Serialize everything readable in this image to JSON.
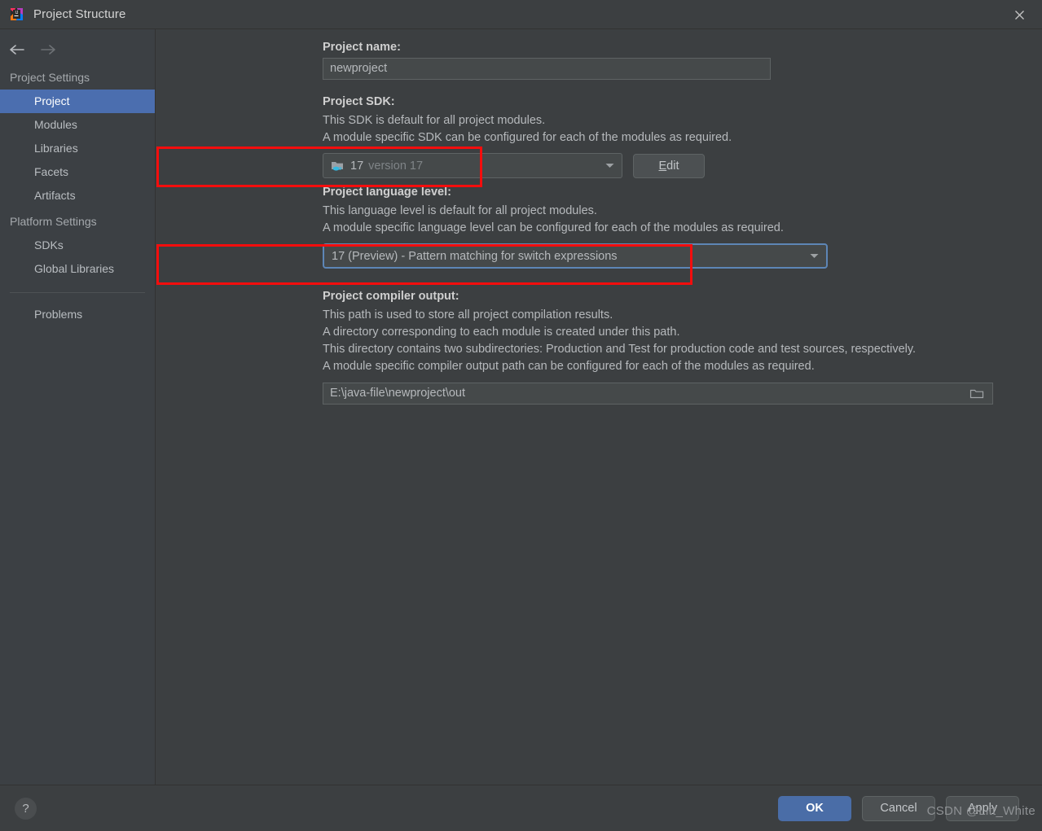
{
  "window": {
    "title": "Project Structure",
    "app_icon": "intellij-idea-icon",
    "close_icon": "close-icon"
  },
  "nav": {
    "back_icon": "arrow-left-icon",
    "forward_icon": "arrow-right-icon"
  },
  "sidebar": {
    "groups": [
      {
        "label": "Project Settings",
        "items": [
          {
            "label": "Project",
            "selected": true
          },
          {
            "label": "Modules",
            "selected": false
          },
          {
            "label": "Libraries",
            "selected": false
          },
          {
            "label": "Facets",
            "selected": false
          },
          {
            "label": "Artifacts",
            "selected": false
          }
        ]
      },
      {
        "label": "Platform Settings",
        "items": [
          {
            "label": "SDKs",
            "selected": false
          },
          {
            "label": "Global Libraries",
            "selected": false
          }
        ]
      }
    ],
    "extra_item": "Problems"
  },
  "main": {
    "project_name": {
      "label": "Project name:",
      "value": "newproject"
    },
    "project_sdk": {
      "label": "Project SDK:",
      "description": [
        "This SDK is default for all project modules.",
        "A module specific SDK can be configured for each of the modules as required."
      ],
      "selected_version": "17",
      "selected_suffix": "version 17",
      "icon": "java-sdk-folder-icon",
      "dropdown_icon": "chevron-down-icon",
      "edit_button": {
        "mnemonic": "E",
        "rest": "dit"
      }
    },
    "language_level": {
      "label": "Project language level:",
      "description": [
        "This language level is default for all project modules.",
        "A module specific language level can be configured for each of the modules as required."
      ],
      "selected": "17 (Preview) - Pattern matching for switch expressions",
      "dropdown_icon": "chevron-down-icon"
    },
    "compiler_output": {
      "label": "Project compiler output:",
      "description": [
        "This path is used to store all project compilation results.",
        "A directory corresponding to each module is created under this path.",
        "This directory contains two subdirectories: Production and Test for production code and test sources, respectively.",
        "A module specific compiler output path can be configured for each of the modules as required."
      ],
      "value": "E:\\java-file\\newproject\\out",
      "browse_icon": "folder-browse-icon"
    }
  },
  "footer": {
    "help_label": "?",
    "ok_label": "OK",
    "cancel_label": "Cancel",
    "apply_label": "Apply"
  },
  "watermark": "CSDN @Litt_White",
  "annotations": {
    "highlight_color": "#f50d0d",
    "boxes": [
      {
        "name": "sdk-highlight"
      },
      {
        "name": "language-level-highlight"
      }
    ]
  },
  "colors": {
    "accent": "#4b6eaf",
    "primary_button": "#4a6da7",
    "background": "#3c3f41",
    "sidebar_background": "#3c4044",
    "highlight": "#f50d0d",
    "focus_border": "#5d86b6"
  }
}
